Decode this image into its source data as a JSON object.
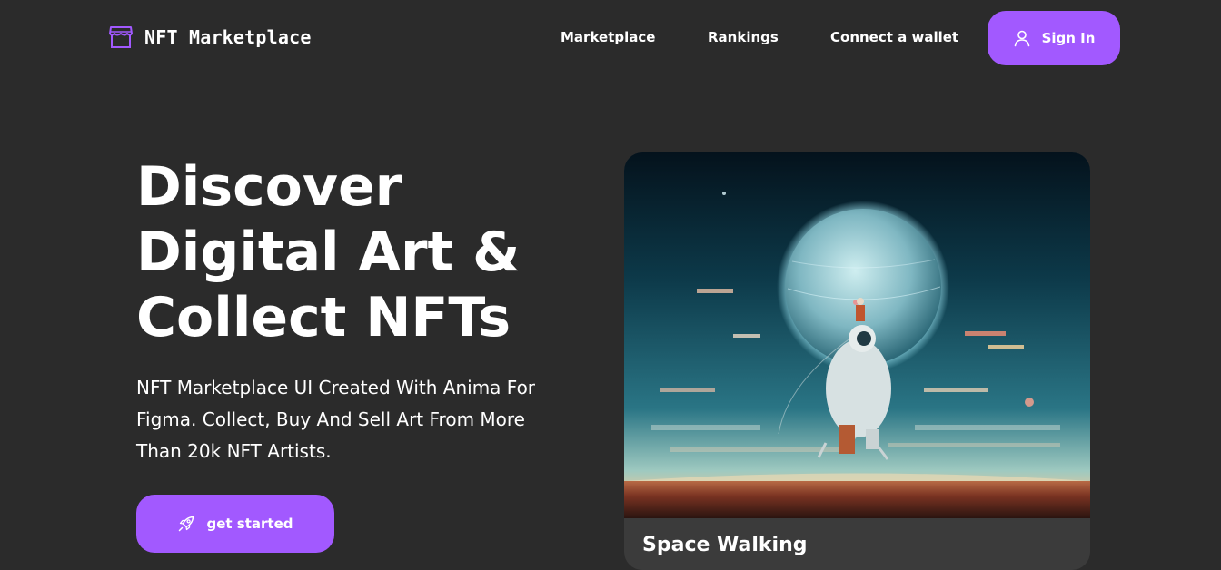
{
  "brand": {
    "name": "NFT Marketplace",
    "logo_icon": "storefront-icon",
    "accent_color": "#a259ff",
    "background_color": "#2b2b2b"
  },
  "nav": {
    "links": [
      "Marketplace",
      "Rankings",
      "Connect a wallet"
    ],
    "signin": {
      "label": "Sign In",
      "icon": "user-icon"
    }
  },
  "hero": {
    "title_lines": [
      "Discover",
      "Digital Art &",
      "Collect NFTs"
    ],
    "description": "NFT Marketplace UI Created With Anima For Figma. Collect, Buy And Sell Art From More Than 20k NFT Artists.",
    "cta": {
      "label": "get started",
      "icon": "rocket-icon"
    }
  },
  "featured_card": {
    "title": "Space Walking",
    "image": "astronaut-planet-artwork"
  }
}
